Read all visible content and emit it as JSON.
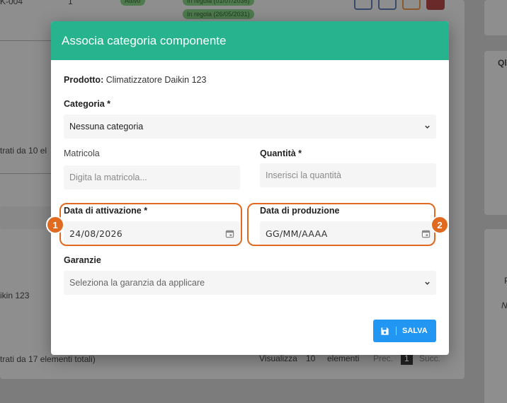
{
  "background": {
    "row_code": "K-004",
    "row_qty": "1",
    "status_active": "Attivo",
    "pill_1": "In regola (01/07/2036)",
    "pill_2": "In regola (26/05/2031)",
    "side_title_fragment": "Ql",
    "filter_text_1": "trati da 10 el",
    "product_fragment": "ikin 123",
    "filter_text_2": "trati da 17 elementi totali)",
    "show_label": "Visualizza",
    "show_count": "10",
    "elements_label": "elementi",
    "prev_label": "Prec.",
    "page_number": "1",
    "next_label": "Succ.",
    "right_col_fragment_1": "P",
    "right_col_fragment_2": "N"
  },
  "modal": {
    "title": "Associa categoria componente",
    "product_label": "Prodotto:",
    "product_value": "Climatizzatore Daikin 123",
    "category_label": "Categoria *",
    "category_value": "Nessuna categoria",
    "serial_label": "Matricola",
    "serial_placeholder": "Digita la matricola...",
    "quantity_label": "Quantità *",
    "quantity_placeholder": "Inserisci la quantità",
    "activation_label": "Data di attivazione *",
    "activation_value": "24/08/2026",
    "production_label": "Data di produzione",
    "production_value": "GG/MM/AAAA",
    "warranty_label": "Garanzie",
    "warranty_placeholder": "Seleziona la garanzia da applicare",
    "save_label": "SALVA"
  },
  "annotations": {
    "badge_1": "1",
    "badge_2": "2",
    "color": "#e06a1f"
  },
  "colors": {
    "header": "#27b38d",
    "save_button": "#2196f3"
  }
}
